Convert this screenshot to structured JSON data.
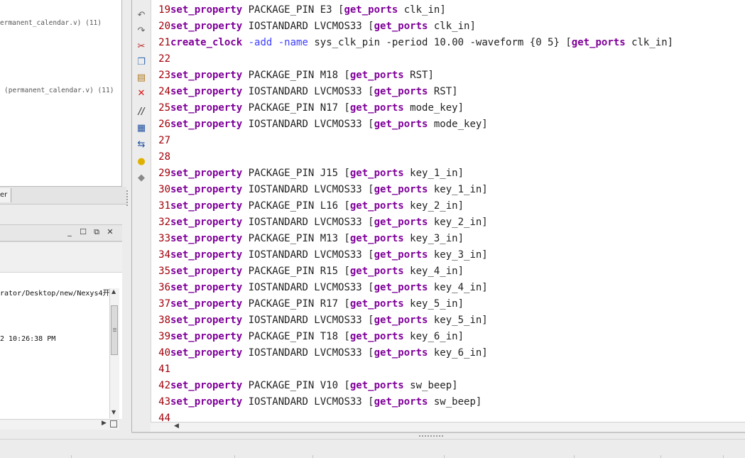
{
  "hierarchy": {
    "line1": "ermanent_calendar.v) (11)",
    "line2": "(permanent_calendar.v) (11)"
  },
  "left_tab": {
    "label": "er"
  },
  "console": {
    "path_text": "rator/Desktop/new/Nexys4开",
    "time_text": "2 10:26:38 PM"
  },
  "editor": {
    "lines": [
      {
        "num": "19",
        "segs": [
          {
            "t": "set_property",
            "k": "kw"
          },
          {
            "t": " PACKAGE_PIN E3 ["
          },
          {
            "t": "get_ports",
            "k": "kw"
          },
          {
            "t": " clk_in]"
          }
        ]
      },
      {
        "num": "20",
        "segs": [
          {
            "t": "set_property",
            "k": "kw"
          },
          {
            "t": " IOSTANDARD LVCMOS33 ["
          },
          {
            "t": "get_ports",
            "k": "kw"
          },
          {
            "t": " clk_in]"
          }
        ]
      },
      {
        "num": "21",
        "segs": [
          {
            "t": "create_clock",
            "k": "kw"
          },
          {
            "t": " "
          },
          {
            "t": "-add",
            "k": "flag"
          },
          {
            "t": " "
          },
          {
            "t": "-name",
            "k": "flag"
          },
          {
            "t": " sys_clk_pin -period 10.00 -waveform {0 5} ["
          },
          {
            "t": "get_ports",
            "k": "kw"
          },
          {
            "t": " clk_in]"
          }
        ]
      },
      {
        "num": "22",
        "segs": []
      },
      {
        "num": "23",
        "segs": [
          {
            "t": "set_property",
            "k": "kw"
          },
          {
            "t": " PACKAGE_PIN M18 ["
          },
          {
            "t": "get_ports",
            "k": "kw"
          },
          {
            "t": " RST]"
          }
        ]
      },
      {
        "num": "24",
        "segs": [
          {
            "t": "set_property",
            "k": "kw"
          },
          {
            "t": " IOSTANDARD LVCMOS33 ["
          },
          {
            "t": "get_ports",
            "k": "kw"
          },
          {
            "t": " RST]"
          }
        ]
      },
      {
        "num": "25",
        "segs": [
          {
            "t": "set_property",
            "k": "kw"
          },
          {
            "t": " PACKAGE_PIN N17 ["
          },
          {
            "t": "get_ports",
            "k": "kw"
          },
          {
            "t": " mode_key]"
          }
        ]
      },
      {
        "num": "26",
        "segs": [
          {
            "t": "set_property",
            "k": "kw"
          },
          {
            "t": " IOSTANDARD LVCMOS33 ["
          },
          {
            "t": "get_ports",
            "k": "kw"
          },
          {
            "t": " mode_key]"
          }
        ]
      },
      {
        "num": "27",
        "segs": []
      },
      {
        "num": "28",
        "segs": []
      },
      {
        "num": "29",
        "segs": [
          {
            "t": "set_property",
            "k": "kw"
          },
          {
            "t": " PACKAGE_PIN J15 ["
          },
          {
            "t": "get_ports",
            "k": "kw"
          },
          {
            "t": " key_1_in]"
          }
        ]
      },
      {
        "num": "30",
        "segs": [
          {
            "t": "set_property",
            "k": "kw"
          },
          {
            "t": " IOSTANDARD LVCMOS33 ["
          },
          {
            "t": "get_ports",
            "k": "kw"
          },
          {
            "t": " key_1_in]"
          }
        ]
      },
      {
        "num": "31",
        "segs": [
          {
            "t": "set_property",
            "k": "kw"
          },
          {
            "t": " PACKAGE_PIN L16 ["
          },
          {
            "t": "get_ports",
            "k": "kw"
          },
          {
            "t": " key_2_in]"
          }
        ]
      },
      {
        "num": "32",
        "segs": [
          {
            "t": "set_property",
            "k": "kw"
          },
          {
            "t": " IOSTANDARD LVCMOS33 ["
          },
          {
            "t": "get_ports",
            "k": "kw"
          },
          {
            "t": " key_2_in]"
          }
        ]
      },
      {
        "num": "33",
        "segs": [
          {
            "t": "set_property",
            "k": "kw"
          },
          {
            "t": " PACKAGE_PIN M13 ["
          },
          {
            "t": "get_ports",
            "k": "kw"
          },
          {
            "t": " key_3_in]"
          }
        ]
      },
      {
        "num": "34",
        "segs": [
          {
            "t": "set_property",
            "k": "kw"
          },
          {
            "t": " IOSTANDARD LVCMOS33 ["
          },
          {
            "t": "get_ports",
            "k": "kw"
          },
          {
            "t": " key_3_in]"
          }
        ]
      },
      {
        "num": "35",
        "segs": [
          {
            "t": "set_property",
            "k": "kw"
          },
          {
            "t": " PACKAGE_PIN R15 ["
          },
          {
            "t": "get_ports",
            "k": "kw"
          },
          {
            "t": " key_4_in]"
          }
        ]
      },
      {
        "num": "36",
        "segs": [
          {
            "t": "set_property",
            "k": "kw"
          },
          {
            "t": " IOSTANDARD LVCMOS33 ["
          },
          {
            "t": "get_ports",
            "k": "kw"
          },
          {
            "t": " key_4_in]"
          }
        ]
      },
      {
        "num": "37",
        "segs": [
          {
            "t": "set_property",
            "k": "kw"
          },
          {
            "t": " PACKAGE_PIN R17 ["
          },
          {
            "t": "get_ports",
            "k": "kw"
          },
          {
            "t": " key_5_in]"
          }
        ]
      },
      {
        "num": "38",
        "segs": [
          {
            "t": "set_property",
            "k": "kw"
          },
          {
            "t": " IOSTANDARD LVCMOS33 ["
          },
          {
            "t": "get_ports",
            "k": "kw"
          },
          {
            "t": " key_5_in]"
          }
        ]
      },
      {
        "num": "39",
        "segs": [
          {
            "t": "set_property",
            "k": "kw"
          },
          {
            "t": " PACKAGE_PIN T18 ["
          },
          {
            "t": "get_ports",
            "k": "kw"
          },
          {
            "t": " key_6_in]"
          }
        ]
      },
      {
        "num": "40",
        "segs": [
          {
            "t": "set_property",
            "k": "kw"
          },
          {
            "t": " IOSTANDARD LVCMOS33 ["
          },
          {
            "t": "get_ports",
            "k": "kw"
          },
          {
            "t": " key_6_in]"
          }
        ]
      },
      {
        "num": "41",
        "segs": []
      },
      {
        "num": "42",
        "segs": [
          {
            "t": "set_property",
            "k": "kw"
          },
          {
            "t": " PACKAGE_PIN V10 ["
          },
          {
            "t": "get_ports",
            "k": "kw"
          },
          {
            "t": " sw_beep]"
          }
        ]
      },
      {
        "num": "43",
        "segs": [
          {
            "t": "set_property",
            "k": "kw"
          },
          {
            "t": " IOSTANDARD LVCMOS33 ["
          },
          {
            "t": "get_ports",
            "k": "kw"
          },
          {
            "t": " sw_beep]"
          }
        ]
      },
      {
        "num": "44",
        "segs": []
      }
    ]
  },
  "colors": {
    "keyword": "#7f0099",
    "flag": "#3d3dff",
    "line_number": "#a0000a"
  },
  "toolbar_icons": [
    "undo-icon",
    "redo-icon",
    "cut-icon",
    "copy-icon",
    "paste-icon",
    "delete-icon",
    "comment-icon",
    "select-all-icon",
    "replace-icon",
    "hint-bulb-icon",
    "stamp-icon"
  ]
}
